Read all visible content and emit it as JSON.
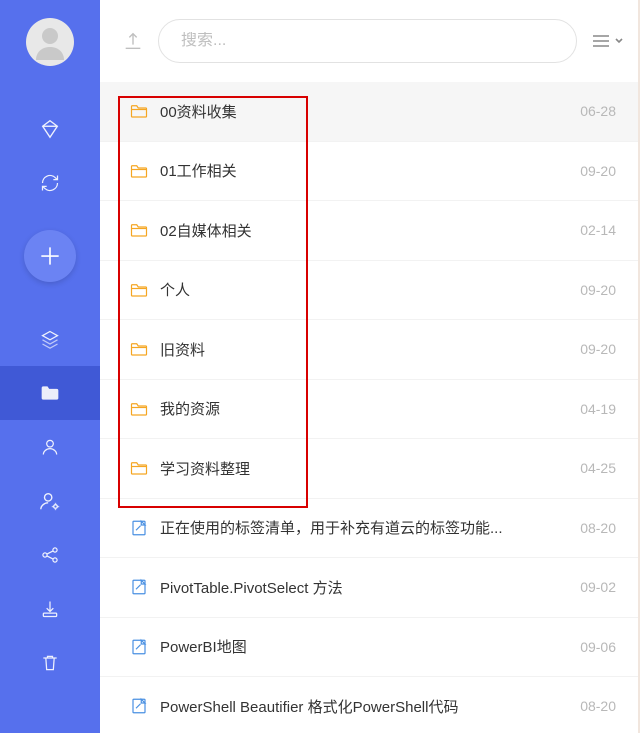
{
  "search": {
    "placeholder": "搜索..."
  },
  "sidebar": {
    "icons": [
      "diamond",
      "sync",
      "add",
      "layers",
      "folder",
      "user",
      "user-settings",
      "share",
      "download",
      "trash"
    ],
    "activeIndex": 4
  },
  "items": [
    {
      "type": "folder",
      "name": "00资料收集",
      "date": "06-28"
    },
    {
      "type": "folder",
      "name": "01工作相关",
      "date": "09-20"
    },
    {
      "type": "folder",
      "name": "02自媒体相关",
      "date": "02-14"
    },
    {
      "type": "folder",
      "name": "个人",
      "date": "09-20"
    },
    {
      "type": "folder",
      "name": "旧资料",
      "date": "09-20"
    },
    {
      "type": "folder",
      "name": "我的资源",
      "date": "04-19"
    },
    {
      "type": "folder",
      "name": "学习资料整理",
      "date": "04-25"
    },
    {
      "type": "note",
      "name": "正在使用的标签清单，用于补充有道云的标签功能...",
      "date": "08-20"
    },
    {
      "type": "note",
      "name": "PivotTable.PivotSelect 方法",
      "date": "09-02"
    },
    {
      "type": "note",
      "name": "PowerBI地图",
      "date": "09-06"
    },
    {
      "type": "note",
      "name": "PowerShell Beautifier 格式化PowerShell代码",
      "date": "08-20"
    }
  ],
  "highlight": {
    "coversItems": 7
  }
}
